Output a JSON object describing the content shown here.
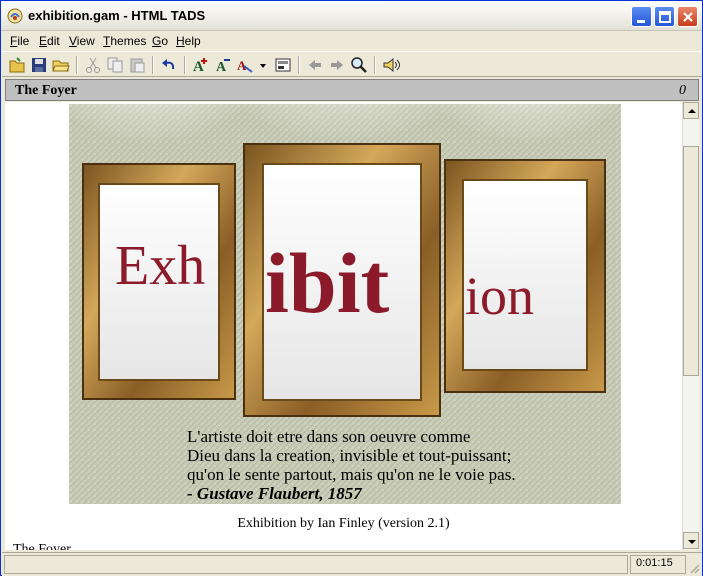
{
  "window": {
    "title": "exhibition.gam - HTML TADS",
    "colors": {
      "accent": "#0831d9",
      "close": "#c43d1b",
      "banner_text": "#8b1a2a"
    }
  },
  "menu": [
    {
      "label": "File",
      "accel": "F"
    },
    {
      "label": "Edit",
      "accel": "E"
    },
    {
      "label": "View",
      "accel": "V"
    },
    {
      "label": "Themes",
      "accel": "T"
    },
    {
      "label": "Go",
      "accel": "G"
    },
    {
      "label": "Help",
      "accel": "H"
    }
  ],
  "toolbar_icons": [
    "open-icon",
    "save-icon",
    "open-folder-icon",
    "cut-icon",
    "copy-icon",
    "paste-icon",
    "undo-icon",
    "font-larger-icon",
    "font-smaller-icon",
    "color-icon",
    "dropdown-icon",
    "options-icon",
    "back-icon",
    "forward-icon",
    "find-icon",
    "sound-icon"
  ],
  "status_line": {
    "room": "The Foyer",
    "score": "0"
  },
  "banner": {
    "word_parts": [
      "Exh",
      "ibit",
      "ion"
    ],
    "quote": [
      "L'artiste doit etre dans son oeuvre comme",
      "Dieu dans la creation, invisible et tout-puissant;",
      "qu'on le sente partout, mais qu'on ne le voie pas."
    ],
    "attribution": "- Gustave Flaubert, 1857"
  },
  "credit": "Exhibition by Ian Finley (version 2.1)",
  "partial_line": "The Foyer",
  "statusbar": {
    "timer": "0:01:15"
  }
}
